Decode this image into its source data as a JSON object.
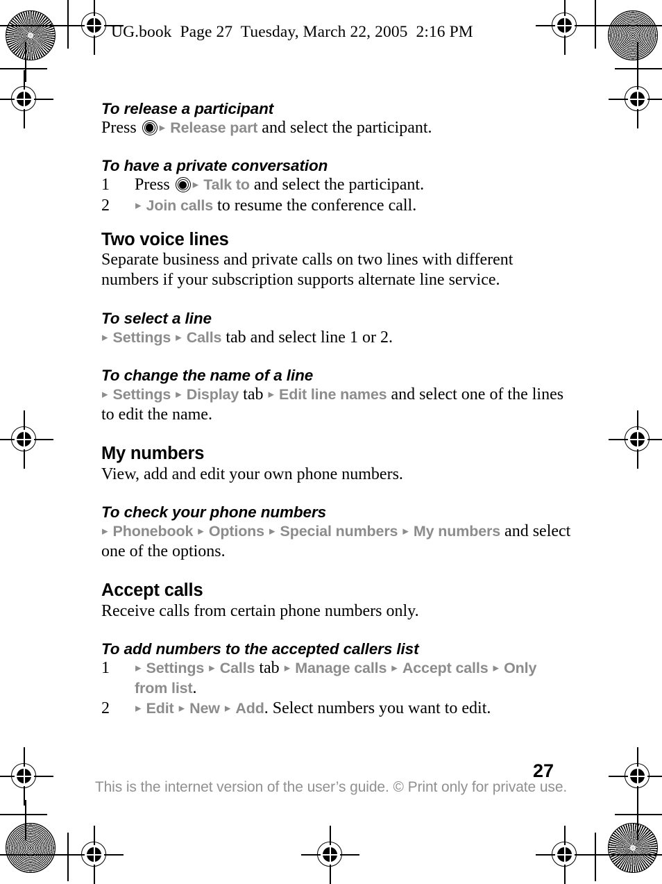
{
  "header": {
    "text": "UG.book  Page 27  Tuesday, March 22, 2005  2:16 PM"
  },
  "footer": {
    "page_number": "27",
    "note": "This is the internet version of the user’s guide. © Print only for private use."
  },
  "icons": {
    "joystick": "joystick-icon",
    "arrow": "▸"
  },
  "colors": {
    "menu_gray": "#8c8c8c",
    "footer_gray": "#909090",
    "text_black": "#000000"
  },
  "sections": {
    "release_participant": {
      "heading": "To release a participant",
      "line_pre": "Press ",
      "menu_1": "Release part",
      "line_post": " and select the participant."
    },
    "private_conversation": {
      "heading": "To have a private conversation",
      "step1_num": "1",
      "step1_pre": "Press ",
      "step1_menu": "Talk to",
      "step1_post": " and select the participant.",
      "step2_num": "2",
      "step2_menu": "Join calls",
      "step2_post": " to resume the conference call."
    },
    "two_voice_lines": {
      "heading": "Two voice lines",
      "body": "Separate business and private calls on two lines with different numbers if your subscription supports alternate line service."
    },
    "select_a_line": {
      "heading": "To select a line",
      "menu_1": "Settings",
      "menu_2": "Calls",
      "post": " tab and select line 1 or 2."
    },
    "change_line_name": {
      "heading": "To change the name of a line",
      "menu_1": "Settings",
      "menu_2": "Display",
      "mid": " tab ",
      "menu_3": "Edit line names",
      "post": " and select one of the lines to edit the name."
    },
    "my_numbers": {
      "heading": "My numbers",
      "body": "View, add and edit your own phone numbers."
    },
    "check_phone_numbers": {
      "heading": "To check your phone numbers",
      "menu_1": "Phonebook",
      "menu_2": "Options",
      "menu_3": "Special numbers",
      "menu_4": "My numbers",
      "post": " and select one of the options."
    },
    "accept_calls": {
      "heading": "Accept calls",
      "body": "Receive calls from certain phone numbers only."
    },
    "add_accepted_callers": {
      "heading": "To add numbers to the accepted callers list",
      "step1_num": "1",
      "step1_menu_1": "Settings",
      "step1_menu_2": "Calls",
      "step1_mid": " tab ",
      "step1_menu_3": "Manage calls",
      "step1_menu_4": "Accept calls",
      "step1_menu_5": "Only from list",
      "step1_post": ".",
      "step2_num": "2",
      "step2_menu_1": "Edit",
      "step2_menu_2": "New",
      "step2_menu_3": "Add",
      "step2_post": ". Select numbers you want to edit."
    }
  }
}
